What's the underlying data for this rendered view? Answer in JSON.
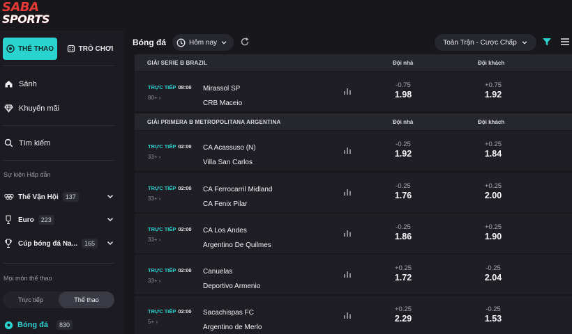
{
  "brand": {
    "line1": "SABA",
    "line2": "SPORTS"
  },
  "sidebar": {
    "tabs": [
      {
        "label": "THỂ THAO",
        "icon": "soccer-ball-icon",
        "active": true
      },
      {
        "label": "TRÒ CHƠI",
        "icon": "dice-icon",
        "active": false
      }
    ],
    "nav": [
      {
        "label": "Sảnh",
        "icon": "home-icon"
      },
      {
        "label": "Khuyến mãi",
        "icon": "diamond-icon"
      },
      {
        "label": "Tìm kiếm",
        "icon": "search-icon"
      }
    ],
    "events_title": "Sự kiện Hấp dẫn",
    "events": [
      {
        "label": "Thế Vận Hội",
        "count": "137",
        "icon": "olympic-rings-icon"
      },
      {
        "label": "Euro",
        "count": "223",
        "icon": "trophy-icon"
      },
      {
        "label": "Cúp bóng đá Na...",
        "count": "165",
        "icon": "cup-icon"
      }
    ],
    "sports_title": "Mọi môn thể thao",
    "segment": {
      "left": "Trực tiếp",
      "right": "Thể thao",
      "selected": "Thể thao"
    },
    "sport": {
      "label": "Bóng đá",
      "count": "830",
      "icon": "soccer-ball-icon"
    }
  },
  "toolbar": {
    "title": "Bóng đá",
    "date_filter": "Hôm nay",
    "market_filter": "Toàn Trận - Cược Chấp"
  },
  "colors": {
    "accent": "#2bd3cf",
    "background": "#17171c",
    "row": "#1e1e24",
    "header": "#26262d"
  },
  "leagues": [
    {
      "name": "GIẢI SERIE B BRAZIL",
      "home_header": "Đội nhà",
      "away_header": "Đội khách",
      "matches": [
        {
          "live": "TRỰC TIẾP",
          "time": "08:00",
          "more": "80+ ›",
          "home": "Mirassol SP",
          "away": "CRB Maceio",
          "home_line": "-0.75",
          "home_odds": "1.98",
          "away_line": "+0.75",
          "away_odds": "1.92"
        }
      ]
    },
    {
      "name": "GIẢI PRIMERA B METROPOLITANA ARGENTINA",
      "home_header": "Đội nhà",
      "away_header": "Đội khách",
      "matches": [
        {
          "live": "TRỰC TIẾP",
          "time": "02:00",
          "more": "33+ ›",
          "home": "CA Acassuso (N)",
          "away": "Villa San Carlos",
          "home_line": "-0.25",
          "home_odds": "1.92",
          "away_line": "+0.25",
          "away_odds": "1.84"
        },
        {
          "live": "TRỰC TIẾP",
          "time": "02:00",
          "more": "33+ ›",
          "home": "CA Ferrocarril Midland",
          "away": "CA Fenix Pilar",
          "home_line": "-0.25",
          "home_odds": "1.76",
          "away_line": "+0.25",
          "away_odds": "2.00"
        },
        {
          "live": "TRỰC TIẾP",
          "time": "02:00",
          "more": "33+ ›",
          "home": "CA Los Andes",
          "away": "Argentino De Quilmes",
          "home_line": "-0.25",
          "home_odds": "1.86",
          "away_line": "+0.25",
          "away_odds": "1.90"
        },
        {
          "live": "TRỰC TIẾP",
          "time": "02:00",
          "more": "33+ ›",
          "home": "Canuelas",
          "away": "Deportivo Armenio",
          "home_line": "+0.25",
          "home_odds": "1.72",
          "away_line": "-0.25",
          "away_odds": "2.04"
        },
        {
          "live": "TRỰC TIẾP",
          "time": "02:00",
          "more": "5+ ›",
          "home": "Sacachispas FC",
          "away": "Argentino de Merlo",
          "home_line": "+0.25",
          "home_odds": "2.29",
          "away_line": "-0.25",
          "away_odds": "1.53"
        }
      ]
    }
  ]
}
